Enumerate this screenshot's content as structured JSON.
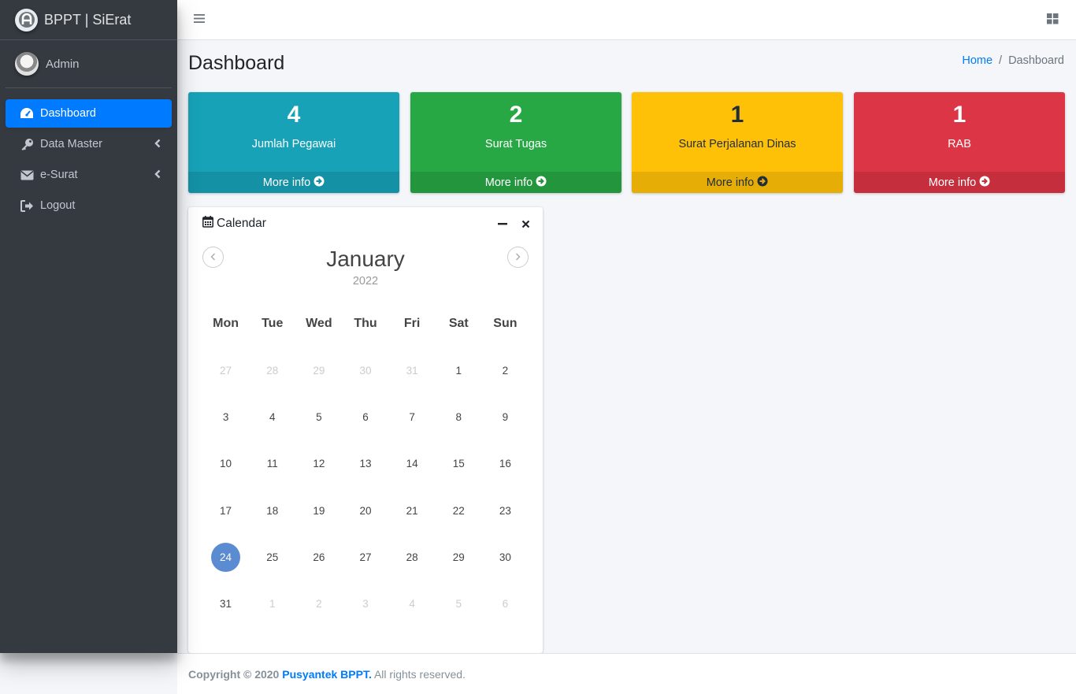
{
  "brand": {
    "text": "BPPT | SiErat"
  },
  "user": {
    "name": "Admin"
  },
  "sidebar": {
    "items": [
      {
        "label": "Dashboard",
        "icon": "tachometer-icon",
        "active": true
      },
      {
        "label": "Data Master",
        "icon": "key-icon",
        "has_submenu": true
      },
      {
        "label": "e-Surat",
        "icon": "envelope-icon",
        "has_submenu": true
      },
      {
        "label": "Logout",
        "icon": "sign-out-icon"
      }
    ]
  },
  "header": {
    "title": "Dashboard"
  },
  "breadcrumb": {
    "home": "Home",
    "separator": "/",
    "current": "Dashboard"
  },
  "stats": [
    {
      "value": "4",
      "label": "Jumlah Pegawai",
      "more": "More info",
      "color": "#17a2b8"
    },
    {
      "value": "2",
      "label": "Surat Tugas",
      "more": "More info",
      "color": "#28a745"
    },
    {
      "value": "1",
      "label": "Surat Perjalanan Dinas",
      "more": "More info",
      "color": "#ffc107"
    },
    {
      "value": "1",
      "label": "RAB",
      "more": "More info",
      "color": "#dc3545"
    }
  ],
  "calendar": {
    "title": "Calendar",
    "month": "January",
    "year": "2022",
    "weekdays": [
      "Mon",
      "Tue",
      "Wed",
      "Thu",
      "Fri",
      "Sat",
      "Sun"
    ],
    "days": [
      {
        "d": "27",
        "m": true
      },
      {
        "d": "28",
        "m": true
      },
      {
        "d": "29",
        "m": true
      },
      {
        "d": "30",
        "m": true
      },
      {
        "d": "31",
        "m": true
      },
      {
        "d": "1"
      },
      {
        "d": "2"
      },
      {
        "d": "3"
      },
      {
        "d": "4"
      },
      {
        "d": "5"
      },
      {
        "d": "6"
      },
      {
        "d": "7"
      },
      {
        "d": "8"
      },
      {
        "d": "9"
      },
      {
        "d": "10"
      },
      {
        "d": "11"
      },
      {
        "d": "12"
      },
      {
        "d": "13"
      },
      {
        "d": "14"
      },
      {
        "d": "15"
      },
      {
        "d": "16"
      },
      {
        "d": "17"
      },
      {
        "d": "18"
      },
      {
        "d": "19"
      },
      {
        "d": "20"
      },
      {
        "d": "21"
      },
      {
        "d": "22"
      },
      {
        "d": "23"
      },
      {
        "d": "24",
        "today": true
      },
      {
        "d": "25"
      },
      {
        "d": "26"
      },
      {
        "d": "27"
      },
      {
        "d": "28"
      },
      {
        "d": "29"
      },
      {
        "d": "30"
      },
      {
        "d": "31"
      },
      {
        "d": "1",
        "m": true
      },
      {
        "d": "2",
        "m": true
      },
      {
        "d": "3",
        "m": true
      },
      {
        "d": "4",
        "m": true
      },
      {
        "d": "5",
        "m": true
      },
      {
        "d": "6",
        "m": true
      }
    ]
  },
  "footer": {
    "prefix": "Copyright © 2020",
    "org": "Pusyantek BPPT.",
    "suffix": "All rights reserved."
  },
  "colors": {
    "sidebar": "#343a40",
    "accent": "#007bff",
    "today": "#5b8bd0"
  }
}
